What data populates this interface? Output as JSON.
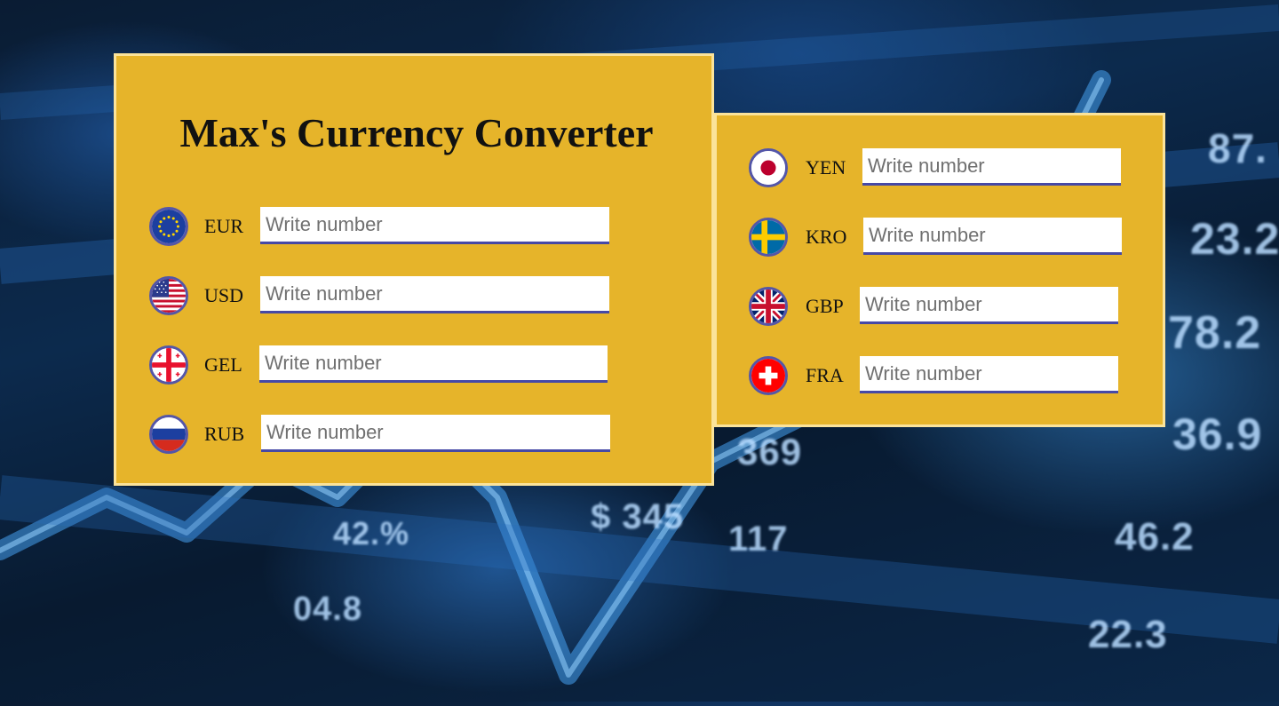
{
  "app": {
    "title": "Max's Currency Converter"
  },
  "converter": {
    "left_currencies": [
      {
        "code": "EUR",
        "flag_icon": "eu-flag-icon",
        "value": "",
        "placeholder": "Write number"
      },
      {
        "code": "USD",
        "flag_icon": "us-flag-icon",
        "value": "",
        "placeholder": "Write number"
      },
      {
        "code": "GEL",
        "flag_icon": "georgia-flag-icon",
        "value": "",
        "placeholder": "Write number"
      },
      {
        "code": "RUB",
        "flag_icon": "russia-flag-icon",
        "value": "",
        "placeholder": "Write number"
      }
    ],
    "right_currencies": [
      {
        "code": "YEN",
        "flag_icon": "japan-flag-icon",
        "value": "",
        "placeholder": "Write number"
      },
      {
        "code": "KRO",
        "flag_icon": "sweden-flag-icon",
        "value": "",
        "placeholder": "Write number"
      },
      {
        "code": "GBP",
        "flag_icon": "uk-flag-icon",
        "value": "",
        "placeholder": "Write number"
      },
      {
        "code": "FRA",
        "flag_icon": "switzerland-flag-icon",
        "value": "",
        "placeholder": "Write number"
      }
    ]
  },
  "background": {
    "numbers": [
      "369",
      "87.",
      "23.2",
      "78.2",
      "36.9",
      "$ 345",
      "117",
      "46.2",
      "42.%",
      "22.3",
      "04.8"
    ]
  },
  "colors": {
    "panel": "#e6b42a",
    "panel_border": "#fbe39a",
    "input_underline": "#4649a6",
    "flag_ring": "#5456a8",
    "background": "#0c2a4d"
  }
}
